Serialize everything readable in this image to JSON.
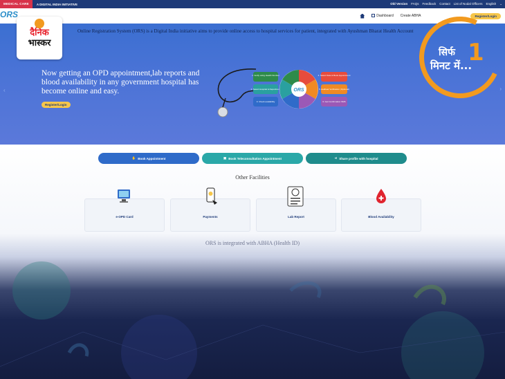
{
  "topbar": {
    "tag": "MEDICAL CARE",
    "initiative": "A DIGITAL INDIA INITIATIVE",
    "links": [
      "Old Version",
      "FAQs",
      "Feedback",
      "Contact",
      "List of Nodal Officers",
      "English"
    ]
  },
  "nav": {
    "logo": "ORS",
    "items": [
      "Dashboard",
      "Create ABHA"
    ],
    "register_login": "Register/Login"
  },
  "brand": {
    "line1": "दैनिक",
    "line2": "भास्कर"
  },
  "hero": {
    "intro": "Online Registration System (ORS) is a Digital India initiative aims to provide online access to hospital services for patient, integrated with Ayushman Bharat Health Account",
    "headline": "Now getting an OPD appointment,lab reports and blood availability in any government hospital has become online and easy.",
    "button": "Register/Login",
    "steps_left": [
      "1. Verify using Health Number",
      "2. Select Hospital & Department",
      "3. Check availability"
    ],
    "steps_right": [
      "4. Select Date & Book Appointment",
      "5. Aadhaar Verification (Optional)",
      "6. Get Confirmation SMS"
    ],
    "center_logo": "ORS"
  },
  "sticker": {
    "line1": "सिर्फ",
    "line2": "मिनट",
    "line3": "में...",
    "number": "1"
  },
  "actions": {
    "book": "Book Appointment",
    "tele": "Book Teleconsultation Appointment",
    "share": "Share profile with hospital"
  },
  "facilities": {
    "title": "Other Facilities",
    "cards": [
      "e-OPD Card",
      "Payments",
      "Lab Report",
      "Blood Availability"
    ]
  },
  "abha": {
    "title": "ORS is integrated with ABHA (Health ID)"
  },
  "colors": {
    "nav_blue": "#1d3a78",
    "hero_blue": "#4a73d6",
    "accent_yellow": "#f6c64a",
    "sticker_orange": "#f29a1f",
    "brand_red": "#e8202a"
  }
}
